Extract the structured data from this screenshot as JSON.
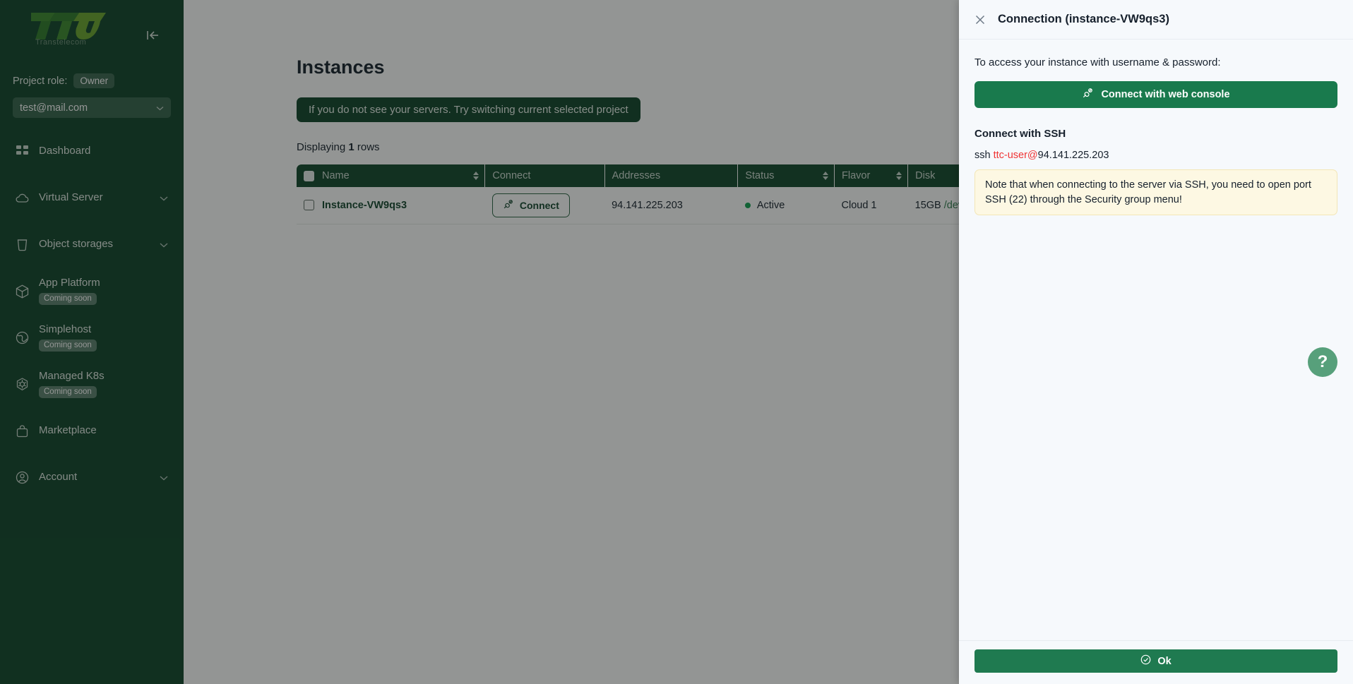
{
  "brand": {
    "logo_text": "TTC",
    "logo_subtitle": "Transtelecom",
    "accent_green": "#0f4429",
    "accent_green_light": "#6aa52e",
    "button_green": "#197a4d",
    "status_green": "#12a150",
    "error_red": "#ef3434",
    "note_yellow": "#fdf8e3"
  },
  "sidebar": {
    "collapse_icon": "collapse-left-icon",
    "role_label": "Project role:",
    "role_value": "Owner",
    "project_value": "test@mail.com",
    "items": [
      {
        "label": "Dashboard",
        "icon": "grid-icon",
        "badge": "",
        "chevron": false
      },
      {
        "label": "Virtual Server",
        "icon": "cloud-icon",
        "badge": "",
        "chevron": true
      },
      {
        "label": "Object storages",
        "icon": "bucket-icon",
        "badge": "",
        "chevron": true
      },
      {
        "label": "App Platform",
        "icon": "cube-icon",
        "badge": "Coming soon",
        "chevron": false
      },
      {
        "label": "Simplehost",
        "icon": "globe-icon",
        "badge": "Coming soon",
        "chevron": false
      },
      {
        "label": "Managed K8s",
        "icon": "kubernetes-icon",
        "badge": "Coming soon",
        "chevron": false
      },
      {
        "label": "Marketplace",
        "icon": "bag-icon",
        "badge": "",
        "chevron": false
      },
      {
        "label": "Account",
        "icon": "user-circle-icon",
        "badge": "",
        "chevron": true
      }
    ]
  },
  "main": {
    "title": "Instances",
    "hint": "If you do not see your servers. Try switching current selected project",
    "displaying_prefix": "Displaying",
    "displaying_count": "1",
    "displaying_suffix": "rows",
    "table": {
      "columns": [
        {
          "label": "Name",
          "sortable": true
        },
        {
          "label": "Connect",
          "sortable": false
        },
        {
          "label": "Addresses",
          "sortable": false
        },
        {
          "label": "Status",
          "sortable": true
        },
        {
          "label": "Flavor",
          "sortable": true
        },
        {
          "label": "Disk",
          "sortable": false
        }
      ],
      "rows": [
        {
          "name": "Instance-VW9qs3",
          "connect_label": "Connect",
          "address": "94.141.225.203",
          "status": "Active",
          "flavor": "Cloud 1",
          "disk_size": "15GB",
          "disk_dev": "/dev/vda"
        }
      ]
    }
  },
  "drawer": {
    "close_icon": "close-icon",
    "title": "Connection (instance-VW9qs3)",
    "access_text": "To access your instance with username & password:",
    "console_button": "Connect with web console",
    "console_icon": "plug-connect-icon",
    "ssh_heading": "Connect with SSH",
    "ssh_prefix": "ssh ",
    "ssh_user": "ttc-user@",
    "ssh_host": "94.141.225.203",
    "note": "Note that when connecting to the server via SSH, you need to open port SSH (22) through the Security group menu!",
    "ok_button": "Ok",
    "ok_icon": "check-circle-icon"
  },
  "help": {
    "label": "?",
    "icon": "question-mark-icon"
  }
}
